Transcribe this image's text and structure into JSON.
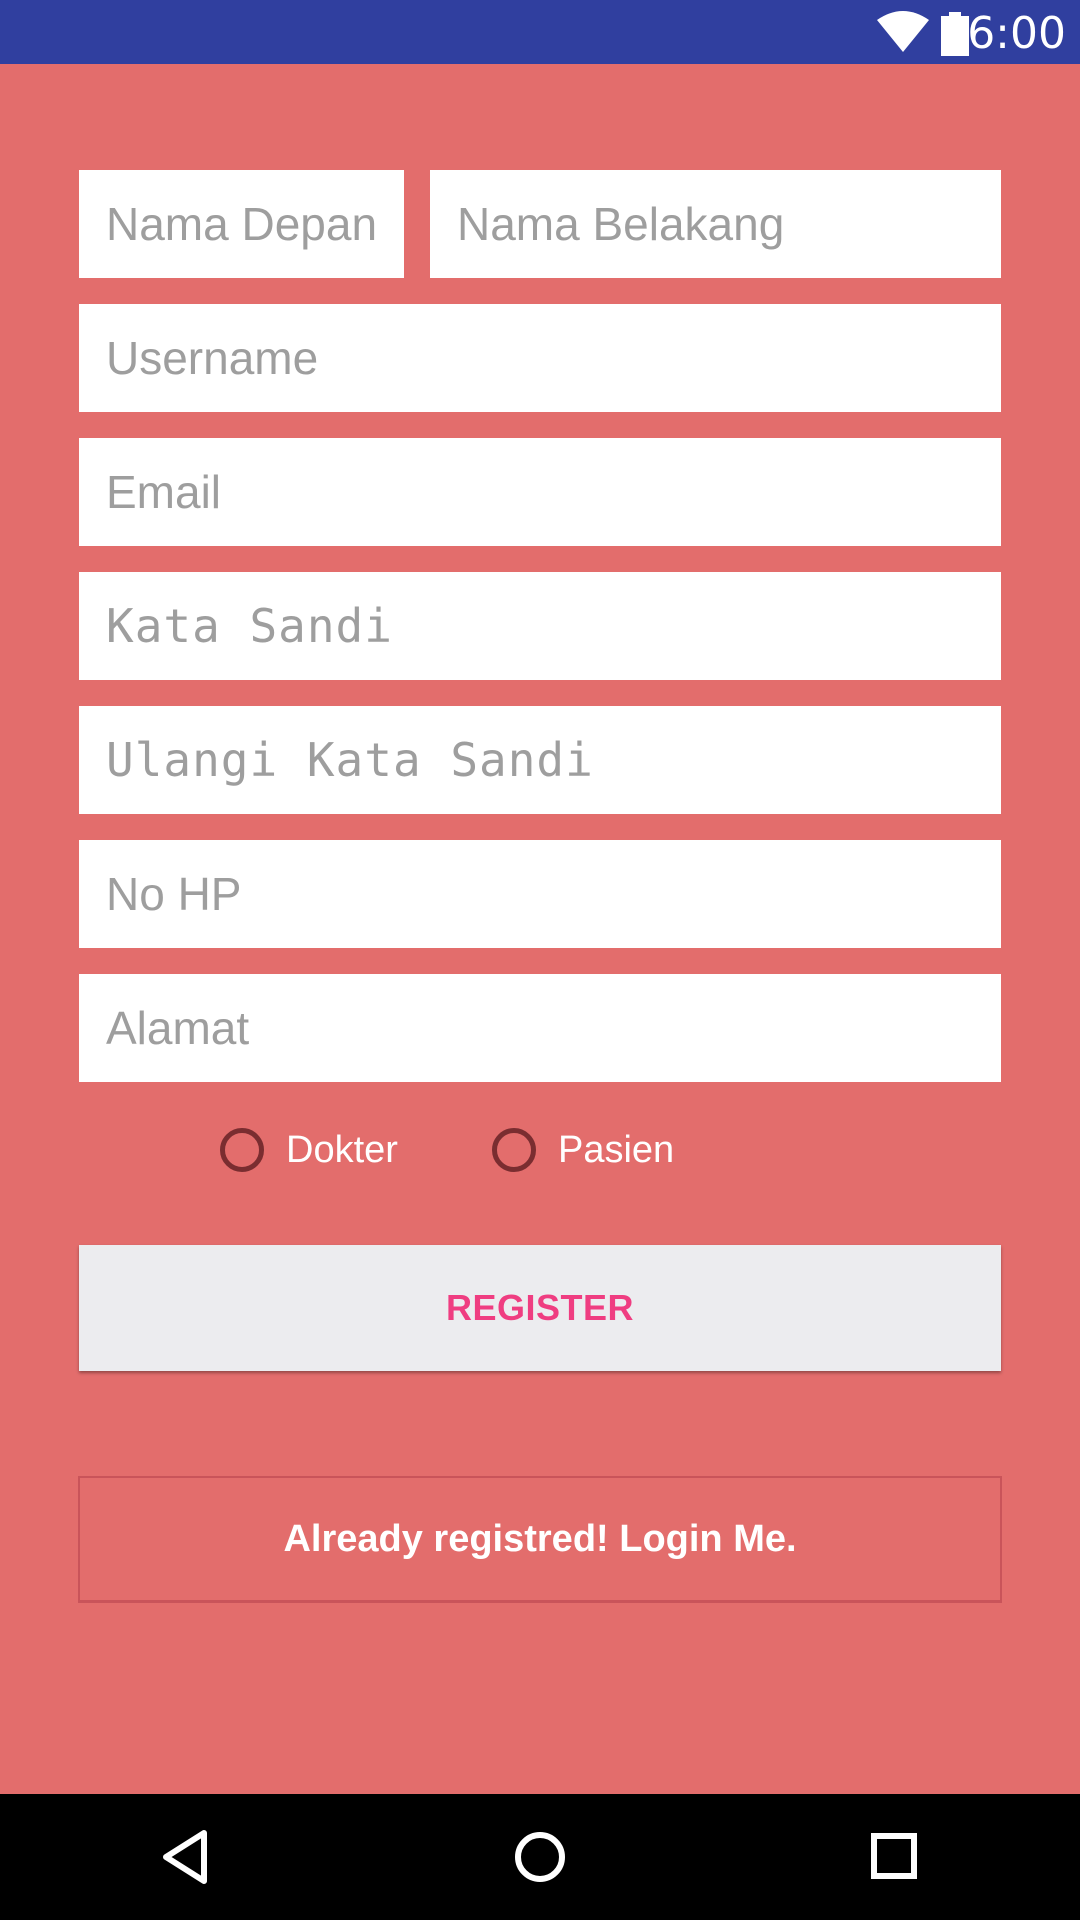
{
  "status_bar": {
    "time": "6:00",
    "icons": [
      "wifi-icon",
      "battery-icon"
    ],
    "background": "#303f9f"
  },
  "form": {
    "first_name_placeholder": "Nama Depan",
    "last_name_placeholder": "Nama Belakang",
    "username_placeholder": "Username",
    "email_placeholder": "Email",
    "password_placeholder": "Kata Sandi",
    "repeat_password_placeholder": "Ulangi Kata Sandi",
    "phone_placeholder": "No HP",
    "address_placeholder": "Alamat"
  },
  "role": {
    "options": [
      "Dokter",
      "Pasien"
    ],
    "selected": null
  },
  "actions": {
    "register_label": "REGISTER",
    "login_label": "Already registred! Login Me."
  },
  "nav_bar": {
    "icons": [
      "back-icon",
      "home-icon",
      "recents-icon"
    ]
  },
  "colors": {
    "background": "#e36d6c",
    "accent": "#ef3d81",
    "placeholder": "#9e9e9e"
  }
}
